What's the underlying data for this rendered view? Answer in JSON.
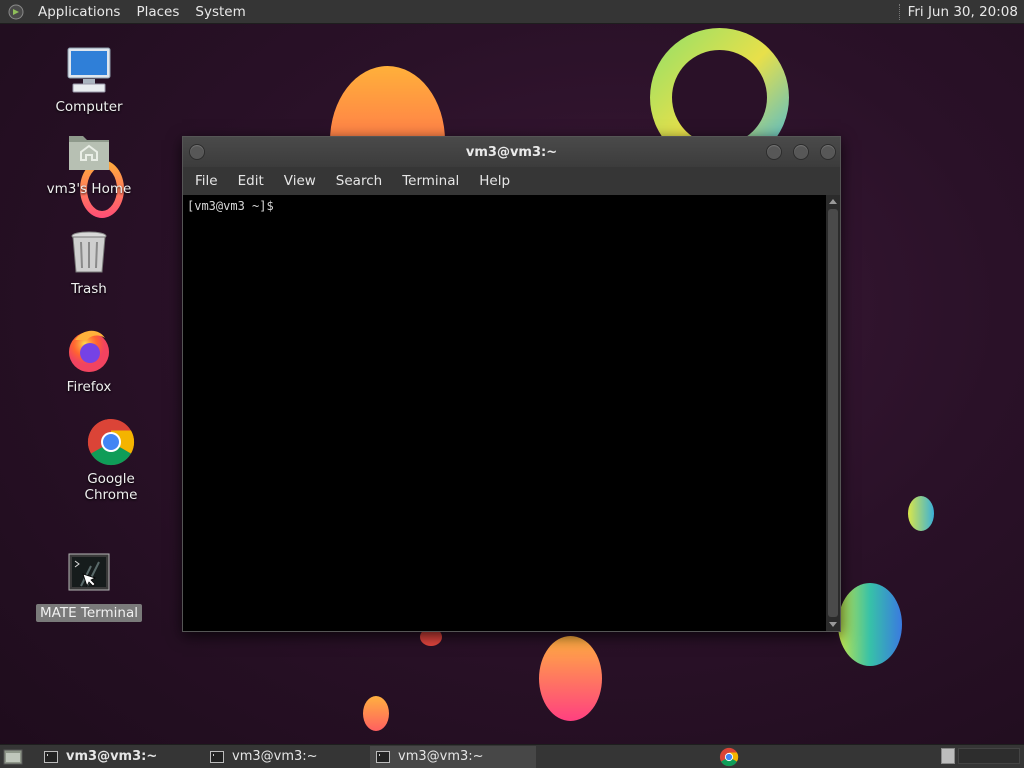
{
  "top_panel": {
    "menus": [
      "Applications",
      "Places",
      "System"
    ],
    "clock": "Fri Jun 30, 20:08"
  },
  "desktop": {
    "icons": [
      {
        "label": "Computer",
        "icon": "computer-icon"
      },
      {
        "label": "vm3's Home",
        "icon": "home-folder-icon"
      },
      {
        "label": "Trash",
        "icon": "trash-icon"
      },
      {
        "label": "Firefox",
        "icon": "firefox-icon"
      },
      {
        "label": "Google Chrome",
        "icon": "chrome-icon"
      },
      {
        "label": "MATE Terminal",
        "icon": "terminal-icon"
      }
    ]
  },
  "window": {
    "title": "vm3@vm3:~",
    "menu": [
      "File",
      "Edit",
      "View",
      "Search",
      "Terminal",
      "Help"
    ],
    "prompt": "[vm3@vm3 ~]$"
  },
  "taskbar": {
    "tasks": [
      {
        "label": "vm3@vm3:~",
        "state": "active"
      },
      {
        "label": "vm3@vm3:~",
        "state": "normal"
      },
      {
        "label": "vm3@vm3:~",
        "state": "hover"
      }
    ]
  },
  "colors": {
    "panel": "#353535",
    "desktop_bg": "#2a1128",
    "terminal_bg": "#000000"
  }
}
